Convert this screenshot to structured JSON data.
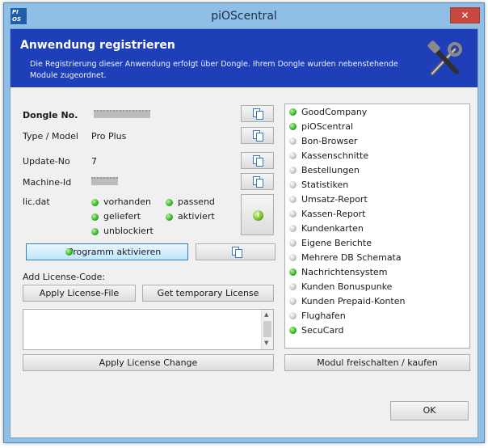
{
  "window": {
    "title": "piOScentral",
    "app_icon_text": "PI OS",
    "close_glyph": "✕"
  },
  "header": {
    "title": "Anwendung registrieren",
    "description": "Die Registrierung dieser Anwendung erfolgt über Dongle. Ihrem Dongle wurden nebenstehende Module zugeordnet."
  },
  "fields": {
    "dongle_label": "Dongle No.",
    "type_label": "Type / Model",
    "type_value": "Pro Plus",
    "update_label": "Update-No",
    "update_value": "7",
    "machine_label": "Machine-Id",
    "licdat_label": "lic.dat"
  },
  "lic_status": {
    "vorhanden": "vorhanden",
    "passend": "passend",
    "geliefert": "geliefert",
    "aktiviert": "aktiviert",
    "unblockiert": "unblockiert"
  },
  "buttons": {
    "activate": "Programm aktivieren",
    "apply_license_file": "Apply License-File",
    "get_temp_license": "Get temporary License",
    "apply_license_change": "Apply License Change",
    "modul_freischalten": "Modul freischalten / kaufen",
    "ok": "OK"
  },
  "license_code_label": "Add License-Code:",
  "modules": [
    {
      "name": "GoodCompany",
      "status": "green"
    },
    {
      "name": "piOScentral",
      "status": "green"
    },
    {
      "name": "Bon-Browser",
      "status": "grey"
    },
    {
      "name": "Kassenschnitte",
      "status": "grey"
    },
    {
      "name": "Bestellungen",
      "status": "grey"
    },
    {
      "name": "Statistiken",
      "status": "grey"
    },
    {
      "name": "Umsatz-Report",
      "status": "grey"
    },
    {
      "name": "Kassen-Report",
      "status": "grey"
    },
    {
      "name": "Kundenkarten",
      "status": "grey"
    },
    {
      "name": "Eigene Berichte",
      "status": "grey"
    },
    {
      "name": "Mehrere DB Schemata",
      "status": "grey"
    },
    {
      "name": "Nachrichtensystem",
      "status": "green"
    },
    {
      "name": "Kunden Bonuspunke",
      "status": "grey"
    },
    {
      "name": "Kunden Prepaid-Konten",
      "status": "grey"
    },
    {
      "name": "Flughafen",
      "status": "grey"
    },
    {
      "name": "SecuCard",
      "status": "green"
    }
  ],
  "colors": {
    "header_bg": "#1f3fb8",
    "status_green": "#31b224",
    "status_grey": "#c4c4c4"
  }
}
